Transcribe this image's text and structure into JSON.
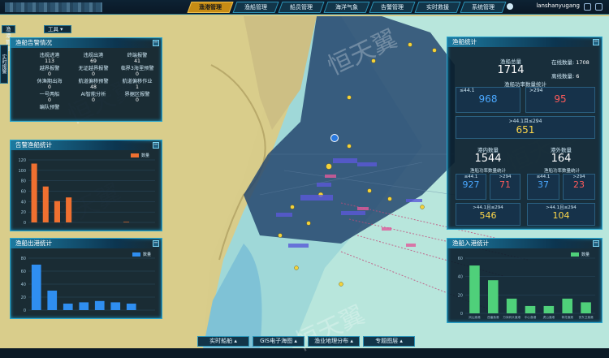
{
  "nav": {
    "items": [
      {
        "label": "渔港管理",
        "active": true
      },
      {
        "label": "渔船管理",
        "active": false
      },
      {
        "label": "船员管理",
        "active": false
      },
      {
        "label": "海洋气象",
        "active": false
      },
      {
        "label": "告警管理",
        "active": false
      },
      {
        "label": "实时救援",
        "active": false
      },
      {
        "label": "系统管理",
        "active": false
      }
    ],
    "username": "lanshanyugang"
  },
  "subbar": {
    "harbor": "渔港管理",
    "tools": "工具"
  },
  "sidetab": "实时报警",
  "alert_panel": {
    "title": "渔船告警情况",
    "stats": [
      {
        "label": "违规进港",
        "value": "113"
      },
      {
        "label": "违规出港",
        "value": "69"
      },
      {
        "label": "终端报警",
        "value": "41"
      },
      {
        "label": "越界报警",
        "value": "0"
      },
      {
        "label": "无证越界报警",
        "value": "0"
      },
      {
        "label": "临界3海里预警",
        "value": "0"
      },
      {
        "label": "休渔期出海",
        "value": "0"
      },
      {
        "label": "航道偏移预警",
        "value": "48"
      },
      {
        "label": "航道偏移作业",
        "value": "1"
      },
      {
        "label": "一号两船",
        "value": "0"
      },
      {
        "label": "AI智能分析",
        "value": "0"
      },
      {
        "label": "界据区报警",
        "value": "0"
      },
      {
        "label": "编队预警",
        "value": ""
      }
    ]
  },
  "alert_chart": {
    "title": "告警渔船统计",
    "legend": "数量",
    "chart_data": {
      "type": "bar",
      "color": "#f07030",
      "ylim": [
        0,
        120
      ],
      "yticks": [
        "0",
        "20",
        "40",
        "60",
        "80",
        "100",
        "120"
      ],
      "values": [
        113,
        69,
        41,
        48,
        0,
        0,
        0,
        0,
        1,
        0,
        0
      ]
    }
  },
  "harbor_chart": {
    "title": "渔船出港统计",
    "legend": "数量",
    "chart_data": {
      "type": "bar",
      "color": "#2f8ef0",
      "ylim": [
        0,
        80
      ],
      "yticks": [
        "0",
        "20",
        "40",
        "60",
        "80"
      ],
      "values": [
        70,
        30,
        10,
        12,
        14,
        12,
        10,
        0
      ]
    }
  },
  "vessel_panel": {
    "title": "渔船统计",
    "total_label": "渔船总量",
    "total": "1714",
    "online_label": "在线数量",
    "online": "1708",
    "offline_label": "离线数量",
    "offline": "6",
    "power_label": "渔船功率数量统计",
    "le44_label": "≤44.1",
    "le44": "968",
    "gt294_label": ">294",
    "gt294": "95",
    "mid_label": ">44.1且≤294",
    "mid": "651",
    "in_port_label": "港内数量",
    "in_port": "1544",
    "out_port_label": "港外数量",
    "out_port": "164",
    "in_power_label": "渔船功率数量统计",
    "out_power_label": "渔船功率数量统计",
    "in_le44_label": "≤44.1",
    "in_le44": "927",
    "in_gt294_label": ">294",
    "in_gt294": "71",
    "out_le44_label": "≤44.1",
    "out_le44": "37",
    "out_gt294_label": ">294",
    "out_gt294": "23",
    "in_mid_label": ">44.1且≤294",
    "in_mid": "546",
    "out_mid_label": ">44.1且≤294",
    "out_mid": "104"
  },
  "inout_chart": {
    "title": "渔船入港统计",
    "legend": "数量",
    "chart_data": {
      "type": "bar",
      "color": "#4fd07a",
      "ylim": [
        0,
        60
      ],
      "yticks": [
        "0",
        "20",
        "40",
        "60"
      ],
      "values": [
        52,
        36,
        16,
        8,
        8,
        16,
        12
      ],
      "categories": [
        "岚山渔港",
        "西潘渔港",
        "万米码头渔港",
        "中心渔港",
        "虎山渔港",
        "荷花渔港",
        "安东卫渔港"
      ]
    }
  },
  "bottom_tabs": [
    "实时船舶",
    "GIS电子海图",
    "渔业地理分布",
    "专题图层"
  ],
  "watermark": "恒天翼",
  "colors": {
    "accent": "#2aa7d0",
    "active": "#c78c14",
    "warn": "#e04040"
  }
}
